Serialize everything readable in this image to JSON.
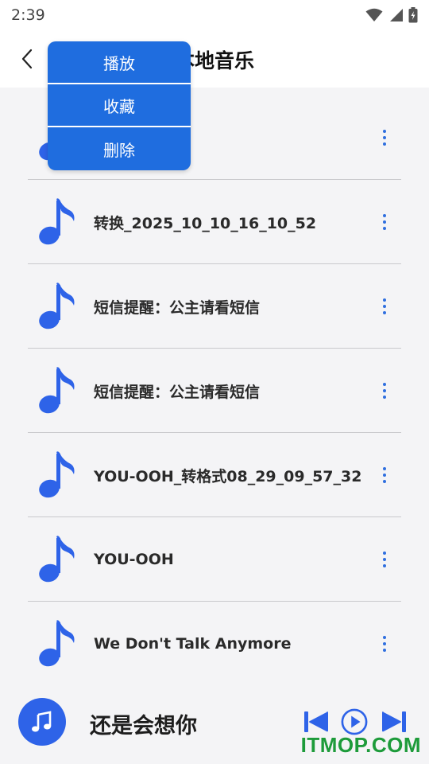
{
  "status_bar": {
    "time": "2:39",
    "icons": [
      "wifi-icon",
      "signal-icon",
      "battery-charging-icon"
    ]
  },
  "header": {
    "back_icon": "chevron-left-icon",
    "title": "本地音乐"
  },
  "popup_menu": {
    "items": [
      {
        "label": "播放"
      },
      {
        "label": "收藏"
      },
      {
        "label": "删除"
      }
    ]
  },
  "songs": [
    {
      "title": "",
      "icon": "music-note-icon"
    },
    {
      "title": "转换_2025_10_10_16_10_52",
      "icon": "music-note-icon"
    },
    {
      "title": "短信提醒：公主请看短信",
      "icon": "music-note-icon"
    },
    {
      "title": "短信提醒：公主请看短信",
      "icon": "music-note-icon"
    },
    {
      "title": "YOU-OOH_转格式08_29_09_57_32",
      "icon": "music-note-icon"
    },
    {
      "title": "YOU-OOH",
      "icon": "music-note-icon"
    },
    {
      "title": "We Don't Talk Anymore",
      "icon": "music-note-icon"
    }
  ],
  "player": {
    "now_playing": "还是会想你",
    "controls": [
      "skip-previous-icon",
      "play-icon",
      "skip-next-icon"
    ]
  },
  "watermark": "ITMOP.COM",
  "colors": {
    "accent": "#2e63e8",
    "menu_bg": "#1f6ddf",
    "list_bg": "#f4f4f6",
    "watermark": "#1d9b3a"
  }
}
